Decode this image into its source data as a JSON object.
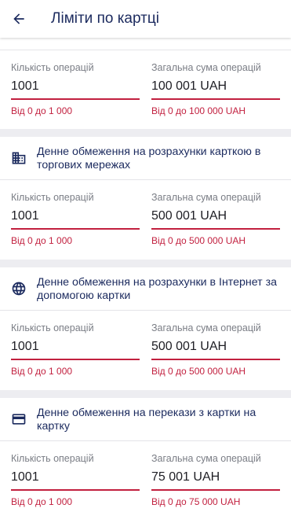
{
  "header": {
    "title": "Ліміти по картці",
    "back_icon": "arrow-left-icon"
  },
  "colors": {
    "accent": "#c2203f",
    "title": "#1b2a5e",
    "background": "#ededf1"
  },
  "sections": [
    {
      "title": "",
      "icon": "",
      "count_label": "Кількість операцій",
      "count_value": "1001",
      "count_hint": "Від 0 до 1 000",
      "sum_label": "Загальна сума операцій",
      "sum_value": "100 001 UAH",
      "sum_hint": "Від 0 до 100 000 UAH"
    },
    {
      "title": "Денне обмеження на розрахунки карткою в торгових мережах",
      "icon": "store-icon",
      "count_label": "Кількість операцій",
      "count_value": "1001",
      "count_hint": "Від 0 до 1 000",
      "sum_label": "Загальна сума операцій",
      "sum_value": "500 001 UAH",
      "sum_hint": "Від 0 до 500 000 UAH"
    },
    {
      "title": "Денне обмеження на розрахунки в Інтернет за допомогою картки",
      "icon": "globe-icon",
      "count_label": "Кількість операцій",
      "count_value": "1001",
      "count_hint": "Від 0 до 1 000",
      "sum_label": "Загальна сума операцій",
      "sum_value": "500 001 UAH",
      "sum_hint": "Від 0 до 500 000 UAH"
    },
    {
      "title": "Денне обмеження на перекази з картки на картку",
      "icon": "credit-card-icon",
      "count_label": "Кількість операцій",
      "count_value": "1001",
      "count_hint": "Від 0 до 1 000",
      "sum_label": "Загальна сума операцій",
      "sum_value": "75 001 UAH",
      "sum_hint": "Від 0 до 75 000 UAH"
    }
  ]
}
